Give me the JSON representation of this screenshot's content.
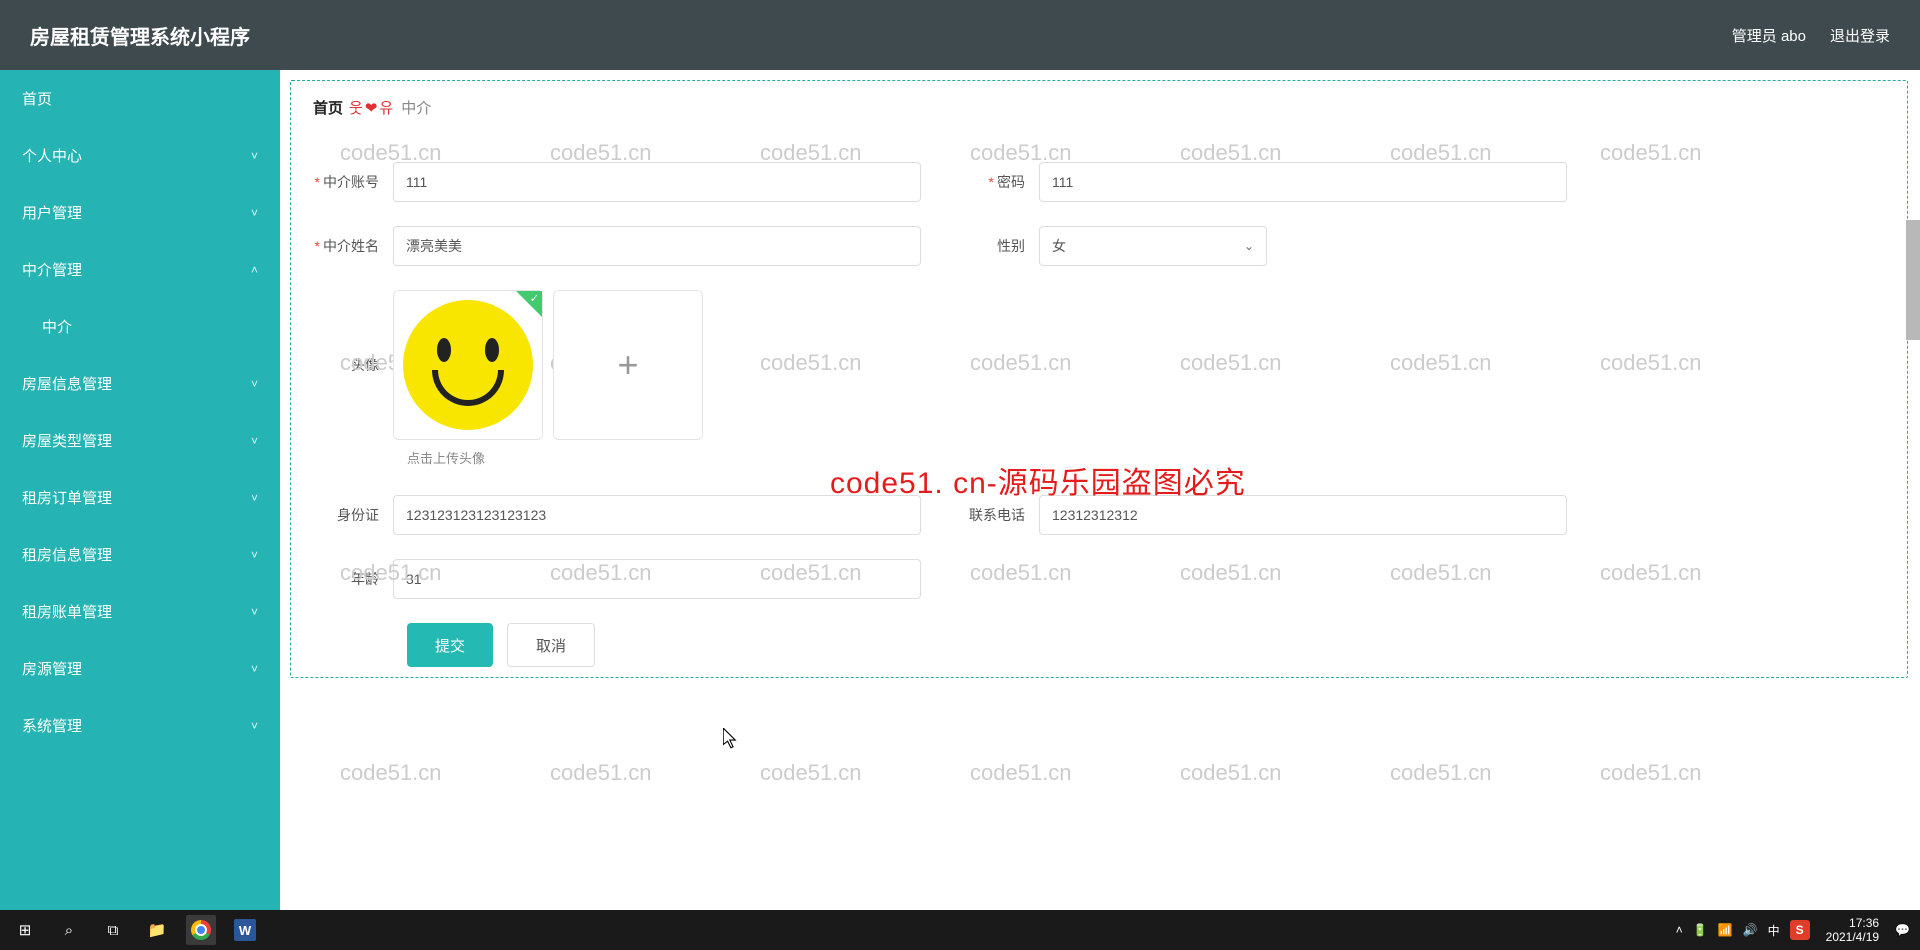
{
  "header": {
    "title": "房屋租赁管理系统小程序",
    "user": "管理员 abo",
    "logout": "退出登录"
  },
  "sidebar": {
    "items": [
      {
        "label": "首页",
        "expand": false,
        "hasChev": false
      },
      {
        "label": "个人中心",
        "expand": false,
        "hasChev": true
      },
      {
        "label": "用户管理",
        "expand": false,
        "hasChev": true
      },
      {
        "label": "中介管理",
        "expand": true,
        "hasChev": true,
        "sub": [
          {
            "label": "中介"
          }
        ]
      },
      {
        "label": "房屋信息管理",
        "expand": false,
        "hasChev": true
      },
      {
        "label": "房屋类型管理",
        "expand": false,
        "hasChev": true
      },
      {
        "label": "租房订单管理",
        "expand": false,
        "hasChev": true
      },
      {
        "label": "租房信息管理",
        "expand": false,
        "hasChev": true
      },
      {
        "label": "租房账单管理",
        "expand": false,
        "hasChev": true
      },
      {
        "label": "房源管理",
        "expand": false,
        "hasChev": true
      },
      {
        "label": "系统管理",
        "expand": false,
        "hasChev": true
      }
    ]
  },
  "breadcrumb": {
    "home": "首页",
    "sep": "웃❤유",
    "current": "中介"
  },
  "form": {
    "account": {
      "label": "中介账号",
      "value": "111",
      "required": true
    },
    "password": {
      "label": "密码",
      "value": "111",
      "required": true
    },
    "name": {
      "label": "中介姓名",
      "value": "漂亮美美",
      "required": true
    },
    "gender": {
      "label": "性别",
      "value": "女"
    },
    "avatar": {
      "label": "头像",
      "hint": "点击上传头像"
    },
    "idcard": {
      "label": "身份证",
      "value": "123123123123123123"
    },
    "phone": {
      "label": "联系电话",
      "value": "12312312312"
    },
    "age": {
      "label": "年龄",
      "value": "31"
    },
    "submit": "提交",
    "cancel": "取消"
  },
  "watermark": "code51.cn",
  "red_banner": "code51. cn-源码乐园盗图必究",
  "taskbar": {
    "time": "17:36",
    "date": "2021/4/19",
    "ime": "中"
  }
}
